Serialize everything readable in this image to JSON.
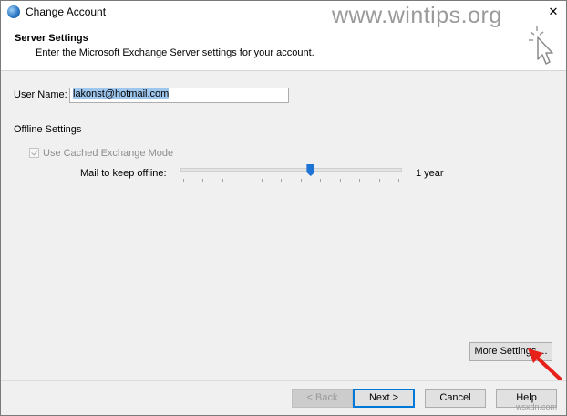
{
  "window": {
    "title": "Change Account",
    "close_glyph": "✕"
  },
  "header": {
    "title": "Server Settings",
    "subtitle": "Enter the Microsoft Exchange Server settings for your account.",
    "watermark": "www.wintips.org"
  },
  "form": {
    "user_name_label": "User Name:",
    "user_name_value": "lakonst@hotmail.com",
    "offline_heading": "Offline Settings",
    "cached_mode_label": "Use Cached Exchange Mode",
    "cached_mode_checked": true,
    "mail_offline_label": "Mail to keep offline:",
    "mail_offline_value": "1 year",
    "slider_position_fraction": 0.59
  },
  "buttons": {
    "more_settings": "More Settings ...",
    "back": "< Back",
    "next": "Next >",
    "cancel": "Cancel",
    "help": "Help"
  },
  "footer_watermark": "wsxdn.com",
  "icons": [
    "app-icon",
    "close-icon",
    "cursor-icon",
    "checkmark-icon",
    "red-arrow-icon"
  ],
  "colors": {
    "accent": "#0078d7",
    "selection": "#9fc7ee",
    "slider_thumb": "#1e73d6",
    "arrow": "#e8201a"
  }
}
